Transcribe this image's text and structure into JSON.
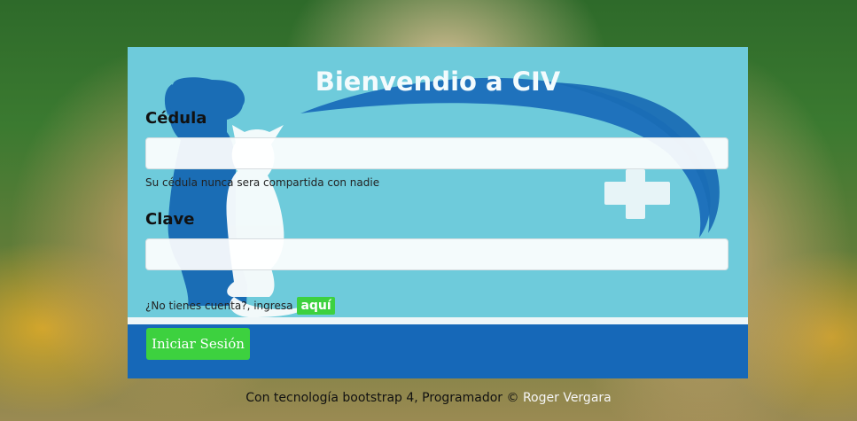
{
  "title": "Bienvendio a CIV",
  "form": {
    "cedula_label": "Cédula",
    "cedula_value": "",
    "cedula_placeholder": "",
    "cedula_help": "Su cédula nunca sera compartida con nadie",
    "clave_label": "Clave",
    "clave_value": "",
    "clave_placeholder": "",
    "register_text": "¿No tienes cuenta?, ingresa",
    "register_link": "aquí",
    "submit_label": "Iniciar Sesión"
  },
  "footer": {
    "text": "Con tecnología bootstrap 4, Programador ©",
    "author": "Roger Vergara"
  },
  "colors": {
    "card": "#6ecbdb",
    "band": "#1668b8",
    "accent": "#3dd13f",
    "dog": "#1a6db5"
  },
  "icons": {
    "logo": "dog-cat-logo-icon",
    "cross": "medical-cross-icon"
  }
}
